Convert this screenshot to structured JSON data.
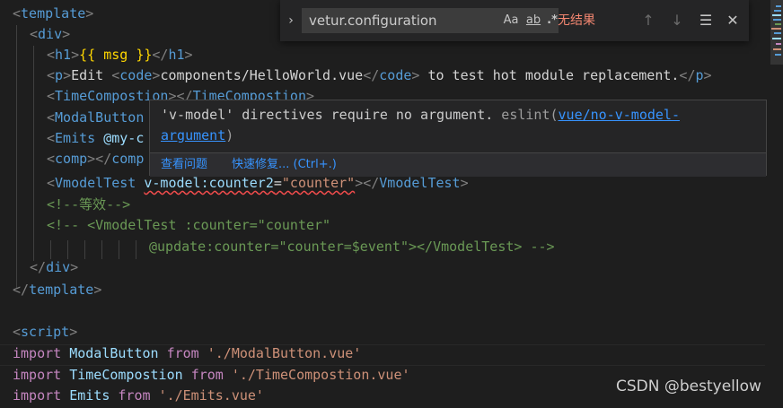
{
  "find_widget": {
    "query": "vetur.configuration",
    "match_case": "Aa",
    "whole_word": "ab",
    "regex": ".*",
    "status": "无结果"
  },
  "hover": {
    "message": "'v-model' directives require no argument.",
    "source": "eslint(",
    "rule_link": "vue/no-v-model-argument",
    "source_close": ")",
    "view_problem": "查看问题",
    "quick_fix": "快速修复... (Ctrl+.)"
  },
  "code": {
    "l1": {
      "open": "<",
      "tag": "template",
      "close": ">"
    },
    "l2": {
      "open": "<",
      "tag": "div",
      "close": ">"
    },
    "l3": {
      "lt": "<",
      "tag": "h1",
      "gt": ">",
      "mus": "{{ msg }}",
      "lt2": "</",
      "gt2": ">"
    },
    "l4": {
      "lt": "<",
      "tag": "p",
      "gt": ">",
      "t1": "Edit ",
      "code_tag": "code",
      "t2": "components/HelloWorld.vue",
      "t3": " to test hot module replacement.",
      "lt2": "</",
      "gt2": ">"
    },
    "l5": {
      "lt": "<",
      "tag": "TimeCompostion",
      "gt": "></",
      "tag2": "TimeCompostion",
      "gt2": ">"
    },
    "l6": {
      "lt": "<",
      "tag": "ModalButton"
    },
    "l7": {
      "lt": "<",
      "tag": "Emits",
      "rest": " @my-c"
    },
    "l8": {
      "lt": "<",
      "tag": "comp",
      "gt": "></",
      "tag2": "comp"
    },
    "l9": {
      "lt": "<",
      "tag": "VmodelTest",
      "attr": "v-model:counter2",
      "eq": "=",
      "val": "\"counter\"",
      "gt": "></",
      "tag2": "VmodelTest",
      "gt2": ">"
    },
    "l10": {
      "text": "<!--等效-->"
    },
    "l11": {
      "text": "<!-- <VmodelTest :counter=\"counter\""
    },
    "l12": {
      "text": "@update:counter=\"counter=$event\"></VmodelTest> -->"
    },
    "l13": {
      "open": "</",
      "tag": "div",
      "close": ">"
    },
    "l14": {
      "open": "</",
      "tag": "template",
      "close": ">"
    },
    "l16": {
      "open": "<",
      "tag": "script",
      "close": ">"
    },
    "l17": {
      "kw": "import",
      "name": "ModalButton",
      "from": "from",
      "path": "'./ModalButton.vue'"
    },
    "l18": {
      "kw": "import",
      "name": "TimeCompostion",
      "from": "from",
      "path": "'./TimeCompostion.vue'"
    },
    "l19": {
      "kw": "import",
      "name": "Emits",
      "from": "from",
      "path": "'./Emits.vue'"
    }
  },
  "watermark": "CSDN @bestyellow",
  "colors": {
    "background": "#1e1e1e",
    "tag": "#569cd6",
    "comment": "#6a9955",
    "keyword": "#c586c0",
    "string": "#ce9178",
    "error": "#f14c4c",
    "link": "#3794ff"
  }
}
